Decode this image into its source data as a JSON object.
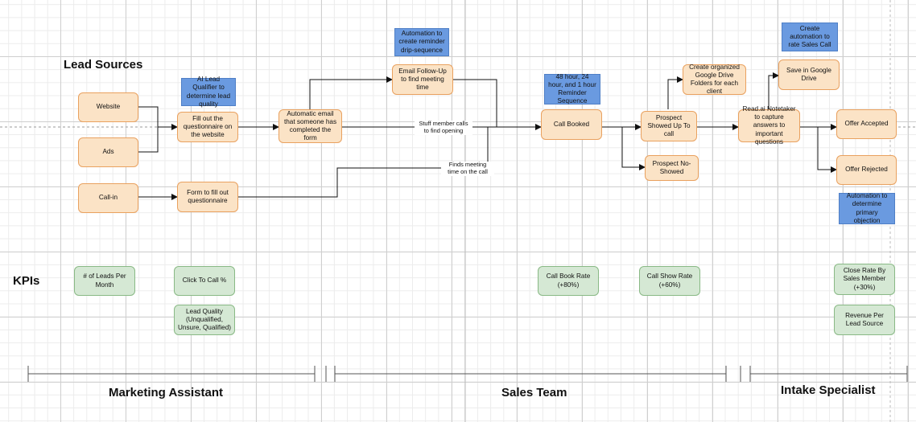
{
  "headings": {
    "lead_sources": "Lead Sources",
    "kpis": "KPIs",
    "marketing_assistant": "Marketing Assistant",
    "sales_team": "Sales Team",
    "intake_specialist": "Intake Specialist"
  },
  "process": {
    "website": "Website",
    "ads": "Ads",
    "call_in": "Call-in",
    "fill_questionnaire": "Fill out the questionnaire on the website",
    "form_questionnaire": "Form to fill out questionnaire",
    "automatic_email": "Automatic email that someone has completed the form",
    "email_follow_up": "Email Follow-Up to find meeting time",
    "call_booked": "Call Booked",
    "prospect_showed": "Prospect Showed Up To call",
    "prospect_no_show": "Prospect No-Showed",
    "google_drive_folders": "Create organized Google Drive Folders for each client",
    "readai": "Read.ai Notetaker to capture answers to important questions",
    "save_google_drive": "Save in Google Drive",
    "offer_accepted": "Offer Accepted",
    "offer_rejected": "Offer Rejected"
  },
  "notes": {
    "ai_lead_qualifier": "AI Lead Qualifier to determine lead quality",
    "reminder_drip": "Automation to create reminder drip-sequence",
    "reminder_sequence": "48 hour, 24 hour, and 1 hour Reminder Sequence",
    "rate_sales_call": "Create automation to rate Sales Call",
    "primary_objection": "Automation to determine primary objection"
  },
  "edge_labels": {
    "staff_calls": "Stuff member calls to find opening",
    "finds_time": "Finds meeting time on the call"
  },
  "kpis": {
    "leads_per_month": "# of Leads Per Month",
    "click_to_call": "Click To Call %",
    "lead_quality": "Lead Quality (Unqualified, Unsure, Qualified)",
    "call_book_rate": "Call Book Rate (+80%)",
    "call_show_rate": "Call Show Rate (+60%)",
    "close_rate": "Close Rate By Sales Member (+30%)",
    "revenue_per_lead": "Revenue Per Lead Source"
  },
  "colors": {
    "process_fill": "#fbe3c6",
    "kpi_fill": "#d5e8d4",
    "note_fill": "#6a9ae0"
  }
}
